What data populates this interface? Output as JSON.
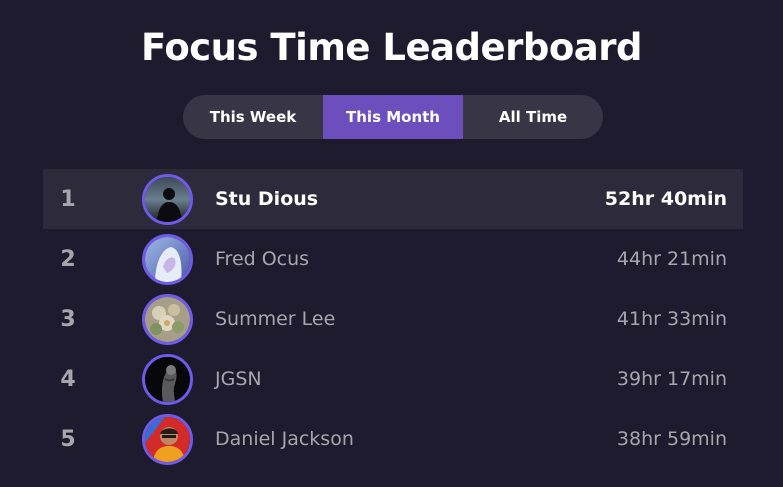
{
  "title": "Focus Time Leaderboard",
  "tabs": [
    {
      "label": "This Week",
      "active": false
    },
    {
      "label": "This Month",
      "active": true
    },
    {
      "label": "All Time",
      "active": false
    }
  ],
  "colors": {
    "background": "#1e1b2e",
    "accent": "#6c4fbd",
    "avatar_ring": "#6e5bea",
    "highlight_row": "#2c2a3b"
  },
  "leaderboard": [
    {
      "rank": "1",
      "name": "Stu Dious",
      "time": "52hr 40min",
      "avatar_icon": "silhouette-avatar-icon"
    },
    {
      "rank": "2",
      "name": "Fred Ocus",
      "time": "44hr 21min",
      "avatar_icon": "hooded-figure-avatar-icon"
    },
    {
      "rank": "3",
      "name": "Summer Lee",
      "time": "41hr 33min",
      "avatar_icon": "flowers-avatar-icon"
    },
    {
      "rank": "4",
      "name": "JGSN",
      "time": "39hr 17min",
      "avatar_icon": "statue-avatar-icon"
    },
    {
      "rank": "5",
      "name": "Daniel Jackson",
      "time": "38hr 59min",
      "avatar_icon": "person-red-avatar-icon"
    }
  ]
}
